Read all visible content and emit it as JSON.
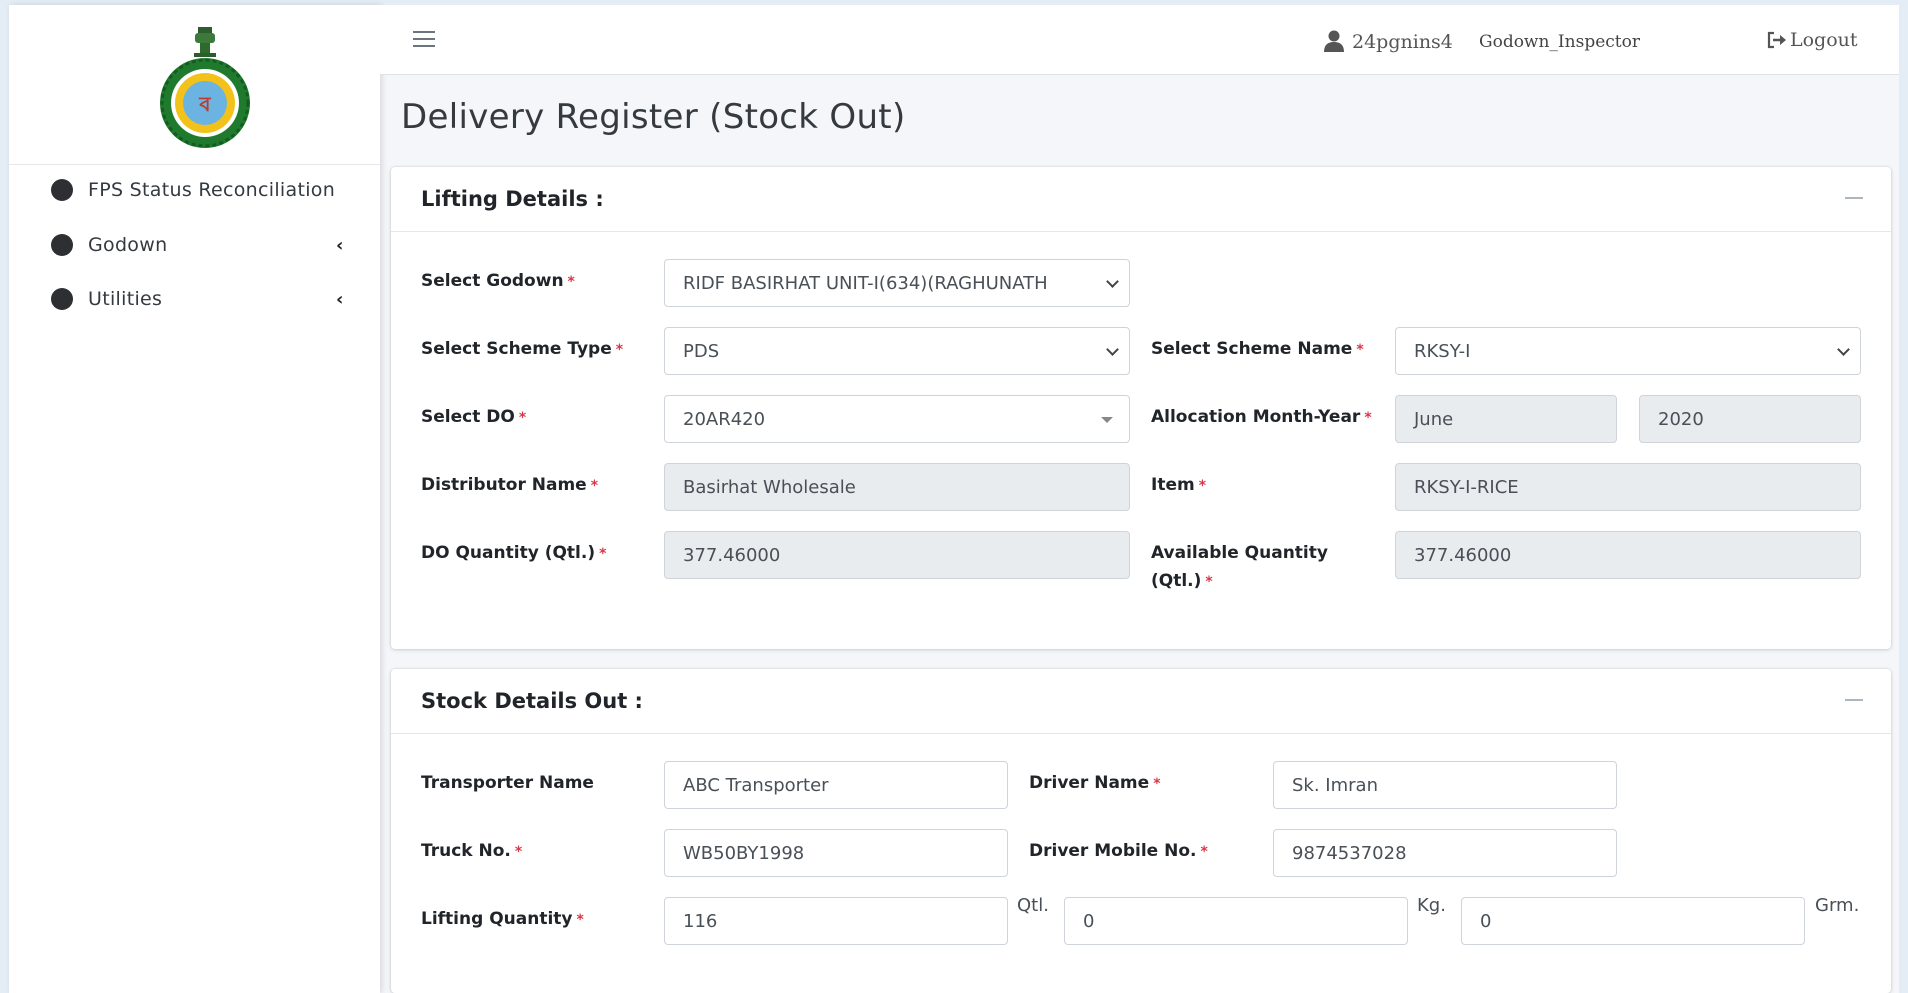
{
  "header": {
    "username": "24pgnins4",
    "role": "Godown_Inspector",
    "logout_label": "Logout"
  },
  "sidebar": {
    "items": [
      {
        "label": "FPS Status Reconciliation"
      },
      {
        "label": "Godown"
      },
      {
        "label": "Utilities"
      }
    ]
  },
  "page": {
    "title": "Delivery Register (Stock Out)"
  },
  "lifting": {
    "title": "Lifting Details :",
    "godown_label": "Select Godown",
    "godown_value": "RIDF BASIRHAT UNIT-I(634)(RAGHUNATH",
    "scheme_type_label": "Select Scheme Type",
    "scheme_type_value": "PDS",
    "scheme_name_label": "Select Scheme Name",
    "scheme_name_value": "RKSY-I",
    "do_label": "Select DO",
    "do_value": "20AR420",
    "alloc_label": "Allocation Month-Year",
    "alloc_month": "June",
    "alloc_year": "2020",
    "distributor_label": "Distributor Name",
    "distributor_value": "Basirhat Wholesale",
    "item_label": "Item",
    "item_value": "RKSY-I-RICE",
    "do_qty_label": "DO Quantity (Qtl.)",
    "do_qty_value": "377.46000",
    "avail_qty_label_1": "Available Quantity",
    "avail_qty_label_2": "(Qtl.)",
    "avail_qty_value": "377.46000",
    "required_mark": "*"
  },
  "stock": {
    "title": "Stock Details Out :",
    "transporter_label": "Transporter Name",
    "transporter_value": "ABC Transporter",
    "driver_label": "Driver Name",
    "driver_value": "Sk. Imran",
    "truck_label": "Truck No.",
    "truck_value": "WB50BY1998",
    "mobile_label": "Driver Mobile No.",
    "mobile_value": "9874537028",
    "lifting_qty_label": "Lifting Quantity",
    "qtl_value": "116",
    "qtl_unit": "Qtl.",
    "kg_value": "0",
    "kg_unit": "Kg.",
    "grm_value": "0",
    "grm_unit": "Grm."
  }
}
